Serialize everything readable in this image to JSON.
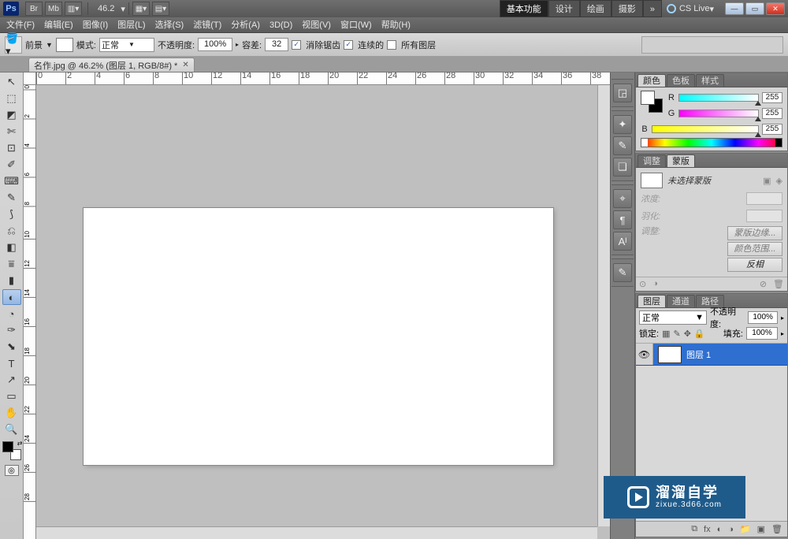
{
  "app": {
    "logo": "Ps",
    "zoom_display": "46.2"
  },
  "workspace": {
    "tabs": [
      "基本功能",
      "设计",
      "绘画",
      "摄影"
    ],
    "more": "»",
    "active": 0,
    "cslive": "CS Live"
  },
  "window": {
    "min": "—",
    "max": "▭",
    "close": "✕"
  },
  "menu": [
    "文件(F)",
    "编辑(E)",
    "图像(I)",
    "图层(L)",
    "选择(S)",
    "滤镜(T)",
    "分析(A)",
    "3D(D)",
    "视图(V)",
    "窗口(W)",
    "帮助(H)"
  ],
  "options": {
    "foreground_label": "前景",
    "mode_label": "模式:",
    "mode_value": "正常",
    "opacity_label": "不透明度:",
    "opacity_value": "100%",
    "tolerance_label": "容差:",
    "tolerance_value": "32",
    "antialias": "消除锯齿",
    "contiguous": "连续的",
    "all_layers": "所有图层"
  },
  "document": {
    "tab_title": "名作.jpg @ 46.2% (图层 1, RGB/8#) *"
  },
  "tools": [
    "↖",
    "⬚",
    "◩",
    "✄",
    "⊡",
    "✐",
    "⌨",
    "✎",
    "⟆",
    "⎌",
    "◧",
    "⩸",
    "▮",
    "◐",
    "◔",
    "✑",
    "⬊",
    "T",
    "↗",
    "▭",
    "✋",
    "🔍"
  ],
  "selected_tool_index": 13,
  "ruler_h": [
    "0",
    "2",
    "4",
    "6",
    "8",
    "10",
    "12",
    "14",
    "16",
    "18",
    "20",
    "22",
    "24",
    "26",
    "28",
    "30",
    "32",
    "34",
    "36",
    "38"
  ],
  "ruler_v": [
    "0",
    "2",
    "4",
    "6",
    "8",
    "10",
    "12",
    "14",
    "16",
    "18",
    "20",
    "22",
    "24",
    "26",
    "28"
  ],
  "dock": {
    "group1": [
      "◲"
    ],
    "group2": [
      "✦",
      "✎",
      "❏"
    ],
    "group3": [
      "⌖",
      "¶",
      "Aᴵ"
    ],
    "group4": [
      "✎"
    ]
  },
  "panels": {
    "color": {
      "tabs": [
        "颜色",
        "色板",
        "样式"
      ],
      "active": 0,
      "r_label": "R",
      "g_label": "G",
      "b_label": "B",
      "r": "255",
      "g": "255",
      "b": "255"
    },
    "masks": {
      "tabs": [
        "调整",
        "蒙版"
      ],
      "active": 1,
      "none": "未选择蒙版",
      "density_label": "浓度:",
      "feather_label": "羽化:",
      "adjust_label": "调整:",
      "btn_edge": "蒙版边缘...",
      "btn_colorrange": "颜色范围...",
      "btn_invert": "反相"
    },
    "layers": {
      "tabs": [
        "图层",
        "通道",
        "路径"
      ],
      "active": 0,
      "blend": "正常",
      "opacity_label": "不透明度:",
      "opacity": "100%",
      "lock_label": "锁定:",
      "fill_label": "填充:",
      "fill": "100%",
      "layer1": "图层 1"
    }
  },
  "watermark": {
    "cn": "溜溜自学",
    "en": "zixue.3d66.com"
  }
}
